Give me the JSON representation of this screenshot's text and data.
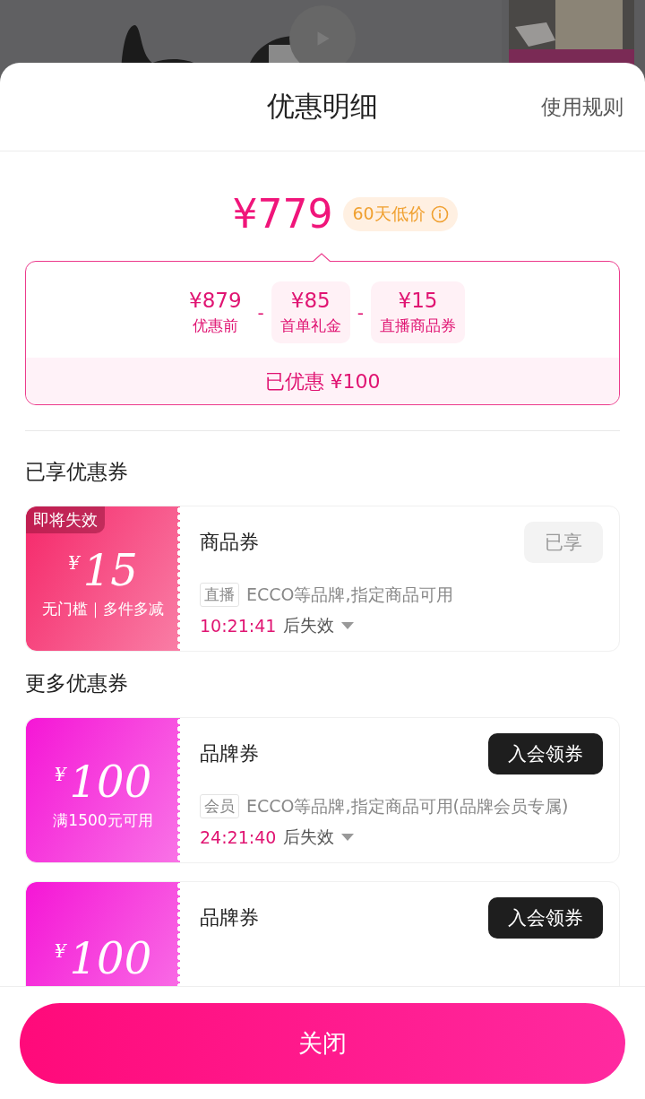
{
  "header": {
    "title": "优惠明细",
    "rules_link": "使用规则"
  },
  "price": {
    "final": "¥779",
    "badge": "60天低价"
  },
  "breakdown": {
    "items": [
      {
        "kind": "base",
        "amount": "¥879",
        "label": "优惠前"
      },
      {
        "kind": "discount",
        "operator": "-",
        "amount": "¥85",
        "label": "首单礼金"
      },
      {
        "kind": "discount",
        "operator": "-",
        "amount": "¥15",
        "label": "直播商品券"
      }
    ],
    "total": "已优惠 ¥100"
  },
  "sections": [
    {
      "title": "已享优惠券",
      "coupons": [
        {
          "color": "#f5286a",
          "expiring_badge": "即将失效",
          "currency": "¥",
          "amount": "15",
          "condition": "无门槛｜多件多减",
          "name": "商品券",
          "button": "已享",
          "disabled": true,
          "tag": "直播",
          "description": "ECCO等品牌,指定商品可用",
          "countdown": "10:21:41",
          "countdown_suffix": "后失效"
        }
      ]
    },
    {
      "title": "更多优惠券",
      "coupons": [
        {
          "color": "#f516d6",
          "currency": "¥",
          "amount": "100",
          "condition": "满1500元可用",
          "name": "品牌券",
          "button": "入会领券",
          "disabled": false,
          "tag": "会员",
          "description": "ECCO等品牌,指定商品可用(品牌会员专属)",
          "countdown": "24:21:40",
          "countdown_suffix": "后失效"
        },
        {
          "color": "#f516d6",
          "currency": "¥",
          "amount": "100",
          "name": "品牌券",
          "button": "入会领券",
          "disabled": false
        }
      ]
    }
  ],
  "footer": {
    "close_button": "关闭"
  }
}
